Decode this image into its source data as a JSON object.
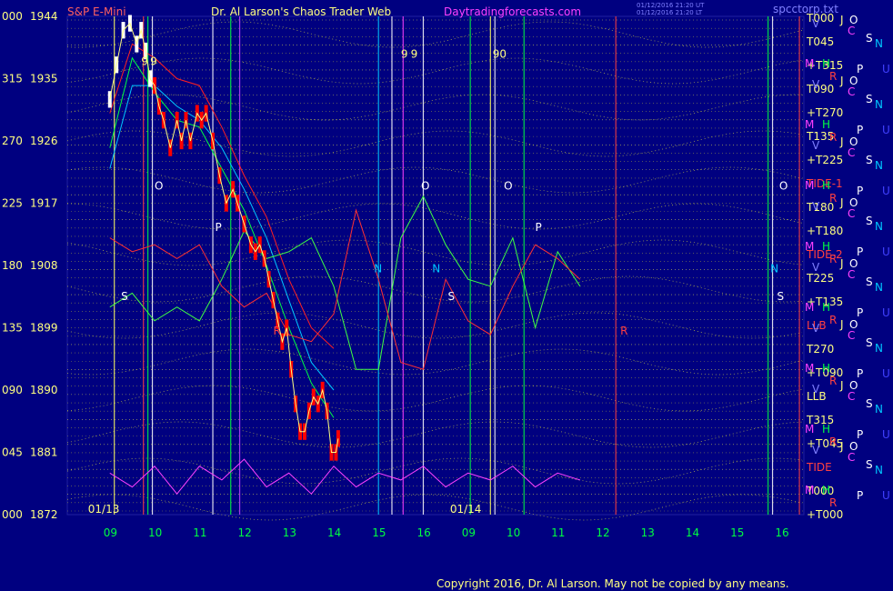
{
  "header": {
    "instrument": "S&P E-Mini",
    "title": "Dr. Al Larson's Chaos Trader Web",
    "site": "Daytradingforecasts.com",
    "timestamp_1": "01/12/2016 21:20 UT",
    "timestamp_2": "01/12/2016 21:20 LT",
    "file": "spcctorp.txt"
  },
  "footer": {
    "copyright": "Copyright 2016, Dr. Al Larson. May not be copied by any means."
  },
  "colors": {
    "background": "#000080",
    "price_bar": "#ff0000",
    "price_white": "#ffffff",
    "date_text": "#00ff00",
    "axis_text": "#ffff80",
    "header_red": "#ff6060",
    "header_magenta": "#ff40ff",
    "grid_yellow": "#c8c850"
  },
  "chart_data": {
    "type": "line",
    "ylim": [
      1872,
      1944
    ],
    "xlabel": "",
    "ylabel": "",
    "y_ticks": [
      {
        "deg": "000",
        "price": "1944",
        "value": 1944
      },
      {
        "deg": "315",
        "price": "1935",
        "value": 1935
      },
      {
        "deg": "270",
        "price": "1926",
        "value": 1926
      },
      {
        "deg": "225",
        "price": "1917",
        "value": 1917
      },
      {
        "deg": "180",
        "price": "1908",
        "value": 1908
      },
      {
        "deg": "135",
        "price": "1899",
        "value": 1899
      },
      {
        "deg": "090",
        "price": "1890",
        "value": 1890
      },
      {
        "deg": "045",
        "price": "1881",
        "value": 1881
      },
      {
        "deg": "000",
        "price": "1872",
        "value": 1872
      }
    ],
    "x_ticks": [
      "09",
      "10",
      "11",
      "12",
      "13",
      "14",
      "15",
      "16",
      "09",
      "10",
      "11",
      "12",
      "13",
      "14",
      "15",
      "16"
    ],
    "day_labels": [
      "01/13",
      "01/14"
    ],
    "right_labels": [
      "T000",
      "T045",
      "+T315",
      "T090",
      "+T270",
      "T135",
      "+T225",
      "TIDE-1",
      "T180",
      "+T180",
      "TIDE-2",
      "T225",
      "+T135",
      "LLB",
      "T270",
      "+T090",
      "LLB",
      "T315",
      "+T045",
      "TIDE",
      "T000",
      "+T000"
    ],
    "planet_labels": [
      "V",
      "J",
      "O",
      "C",
      "S",
      "N",
      "M",
      "H",
      "P",
      "U",
      "R"
    ],
    "marker_labels": [
      "9",
      "90",
      "T",
      "0",
      "O",
      "P",
      "N",
      "S",
      "R"
    ],
    "price_series": [
      {
        "x": 0.0,
        "y": 1932
      },
      {
        "x": 0.15,
        "y": 1937
      },
      {
        "x": 0.3,
        "y": 1942
      },
      {
        "x": 0.45,
        "y": 1943
      },
      {
        "x": 0.6,
        "y": 1940
      },
      {
        "x": 0.7,
        "y": 1942
      },
      {
        "x": 0.8,
        "y": 1939
      },
      {
        "x": 0.9,
        "y": 1935
      },
      {
        "x": 1.0,
        "y": 1934
      },
      {
        "x": 1.1,
        "y": 1931
      },
      {
        "x": 1.2,
        "y": 1929
      },
      {
        "x": 1.35,
        "y": 1925
      },
      {
        "x": 1.5,
        "y": 1929
      },
      {
        "x": 1.6,
        "y": 1926
      },
      {
        "x": 1.7,
        "y": 1929
      },
      {
        "x": 1.8,
        "y": 1926
      },
      {
        "x": 1.95,
        "y": 1930
      },
      {
        "x": 2.05,
        "y": 1929
      },
      {
        "x": 2.15,
        "y": 1930
      },
      {
        "x": 2.3,
        "y": 1926
      },
      {
        "x": 2.45,
        "y": 1921
      },
      {
        "x": 2.6,
        "y": 1917
      },
      {
        "x": 2.75,
        "y": 1919
      },
      {
        "x": 2.85,
        "y": 1917
      },
      {
        "x": 3.0,
        "y": 1914
      },
      {
        "x": 3.15,
        "y": 1911
      },
      {
        "x": 3.25,
        "y": 1910
      },
      {
        "x": 3.35,
        "y": 1911
      },
      {
        "x": 3.45,
        "y": 1909
      },
      {
        "x": 3.55,
        "y": 1906
      },
      {
        "x": 3.65,
        "y": 1903
      },
      {
        "x": 3.75,
        "y": 1900
      },
      {
        "x": 3.85,
        "y": 1897
      },
      {
        "x": 3.95,
        "y": 1899
      },
      {
        "x": 4.05,
        "y": 1893
      },
      {
        "x": 4.15,
        "y": 1888
      },
      {
        "x": 4.25,
        "y": 1884
      },
      {
        "x": 4.35,
        "y": 1884
      },
      {
        "x": 4.45,
        "y": 1887
      },
      {
        "x": 4.55,
        "y": 1889
      },
      {
        "x": 4.65,
        "y": 1888
      },
      {
        "x": 4.75,
        "y": 1890
      },
      {
        "x": 4.85,
        "y": 1887
      },
      {
        "x": 4.95,
        "y": 1881
      },
      {
        "x": 5.05,
        "y": 1881
      },
      {
        "x": 5.1,
        "y": 1883
      }
    ],
    "series": [
      {
        "color": "#00c8ff",
        "points": [
          {
            "x": 0.0,
            "y": 1922
          },
          {
            "x": 0.5,
            "y": 1934
          },
          {
            "x": 1.0,
            "y": 1934
          },
          {
            "x": 1.5,
            "y": 1931
          },
          {
            "x": 2.0,
            "y": 1929
          },
          {
            "x": 2.5,
            "y": 1925
          },
          {
            "x": 3.0,
            "y": 1919
          },
          {
            "x": 3.5,
            "y": 1912
          },
          {
            "x": 4.0,
            "y": 1903
          },
          {
            "x": 4.5,
            "y": 1894
          },
          {
            "x": 5.0,
            "y": 1890
          }
        ]
      },
      {
        "color": "#00ff40",
        "points": [
          {
            "x": 0.0,
            "y": 1925
          },
          {
            "x": 0.5,
            "y": 1938
          },
          {
            "x": 1.0,
            "y": 1933
          },
          {
            "x": 1.5,
            "y": 1929
          },
          {
            "x": 2.0,
            "y": 1928
          },
          {
            "x": 2.5,
            "y": 1922
          },
          {
            "x": 3.0,
            "y": 1916
          },
          {
            "x": 3.5,
            "y": 1908
          },
          {
            "x": 4.0,
            "y": 1899
          },
          {
            "x": 4.5,
            "y": 1891
          },
          {
            "x": 5.0,
            "y": 1886
          }
        ]
      },
      {
        "color": "#ff2020",
        "points": [
          {
            "x": 0.0,
            "y": 1930
          },
          {
            "x": 0.5,
            "y": 1940
          },
          {
            "x": 1.0,
            "y": 1938
          },
          {
            "x": 1.5,
            "y": 1935
          },
          {
            "x": 2.0,
            "y": 1934
          },
          {
            "x": 2.5,
            "y": 1928
          },
          {
            "x": 3.0,
            "y": 1921
          },
          {
            "x": 3.5,
            "y": 1915
          },
          {
            "x": 4.0,
            "y": 1906
          },
          {
            "x": 4.5,
            "y": 1899
          },
          {
            "x": 5.0,
            "y": 1896
          }
        ]
      },
      {
        "color": "#40ff40",
        "points": [
          {
            "x": 0.0,
            "y": 1902
          },
          {
            "x": 0.5,
            "y": 1904
          },
          {
            "x": 1.0,
            "y": 1900
          },
          {
            "x": 1.5,
            "y": 1902
          },
          {
            "x": 2.0,
            "y": 1900
          },
          {
            "x": 2.5,
            "y": 1906
          },
          {
            "x": 3.0,
            "y": 1913
          },
          {
            "x": 3.5,
            "y": 1909
          },
          {
            "x": 4.0,
            "y": 1910
          },
          {
            "x": 4.5,
            "y": 1912
          },
          {
            "x": 5.0,
            "y": 1905
          },
          {
            "x": 5.5,
            "y": 1893
          },
          {
            "x": 6.0,
            "y": 1893
          },
          {
            "x": 6.5,
            "y": 1912
          },
          {
            "x": 7.0,
            "y": 1918
          },
          {
            "x": 7.5,
            "y": 1911
          },
          {
            "x": 8.0,
            "y": 1906
          },
          {
            "x": 8.5,
            "y": 1905
          },
          {
            "x": 9.0,
            "y": 1912
          },
          {
            "x": 9.5,
            "y": 1899
          },
          {
            "x": 10.0,
            "y": 1910
          },
          {
            "x": 10.5,
            "y": 1905
          }
        ]
      },
      {
        "color": "#ff3030",
        "points": [
          {
            "x": 0.0,
            "y": 1912
          },
          {
            "x": 0.5,
            "y": 1910
          },
          {
            "x": 1.0,
            "y": 1911
          },
          {
            "x": 1.5,
            "y": 1909
          },
          {
            "x": 2.0,
            "y": 1911
          },
          {
            "x": 2.5,
            "y": 1905
          },
          {
            "x": 3.0,
            "y": 1902
          },
          {
            "x": 3.5,
            "y": 1904
          },
          {
            "x": 4.0,
            "y": 1898
          },
          {
            "x": 4.5,
            "y": 1897
          },
          {
            "x": 5.0,
            "y": 1901
          },
          {
            "x": 5.5,
            "y": 1916
          },
          {
            "x": 6.0,
            "y": 1906
          },
          {
            "x": 6.5,
            "y": 1894
          },
          {
            "x": 7.0,
            "y": 1893
          },
          {
            "x": 7.5,
            "y": 1906
          },
          {
            "x": 8.0,
            "y": 1900
          },
          {
            "x": 8.5,
            "y": 1898
          },
          {
            "x": 9.0,
            "y": 1905
          },
          {
            "x": 9.5,
            "y": 1911
          },
          {
            "x": 10.0,
            "y": 1909
          },
          {
            "x": 10.5,
            "y": 1906
          }
        ]
      },
      {
        "color": "#ff40ff",
        "points": [
          {
            "x": 0.0,
            "y": 1878
          },
          {
            "x": 0.5,
            "y": 1876
          },
          {
            "x": 1.0,
            "y": 1879
          },
          {
            "x": 1.5,
            "y": 1875
          },
          {
            "x": 2.0,
            "y": 1879
          },
          {
            "x": 2.5,
            "y": 1877
          },
          {
            "x": 3.0,
            "y": 1880
          },
          {
            "x": 3.5,
            "y": 1876
          },
          {
            "x": 4.0,
            "y": 1878
          },
          {
            "x": 4.5,
            "y": 1875
          },
          {
            "x": 5.0,
            "y": 1879
          },
          {
            "x": 5.5,
            "y": 1876
          },
          {
            "x": 6.0,
            "y": 1878
          },
          {
            "x": 6.5,
            "y": 1877
          },
          {
            "x": 7.0,
            "y": 1879
          },
          {
            "x": 7.5,
            "y": 1876
          },
          {
            "x": 8.0,
            "y": 1878
          },
          {
            "x": 8.5,
            "y": 1877
          },
          {
            "x": 9.0,
            "y": 1879
          },
          {
            "x": 9.5,
            "y": 1876
          },
          {
            "x": 10.0,
            "y": 1878
          },
          {
            "x": 10.5,
            "y": 1877
          }
        ]
      }
    ]
  }
}
